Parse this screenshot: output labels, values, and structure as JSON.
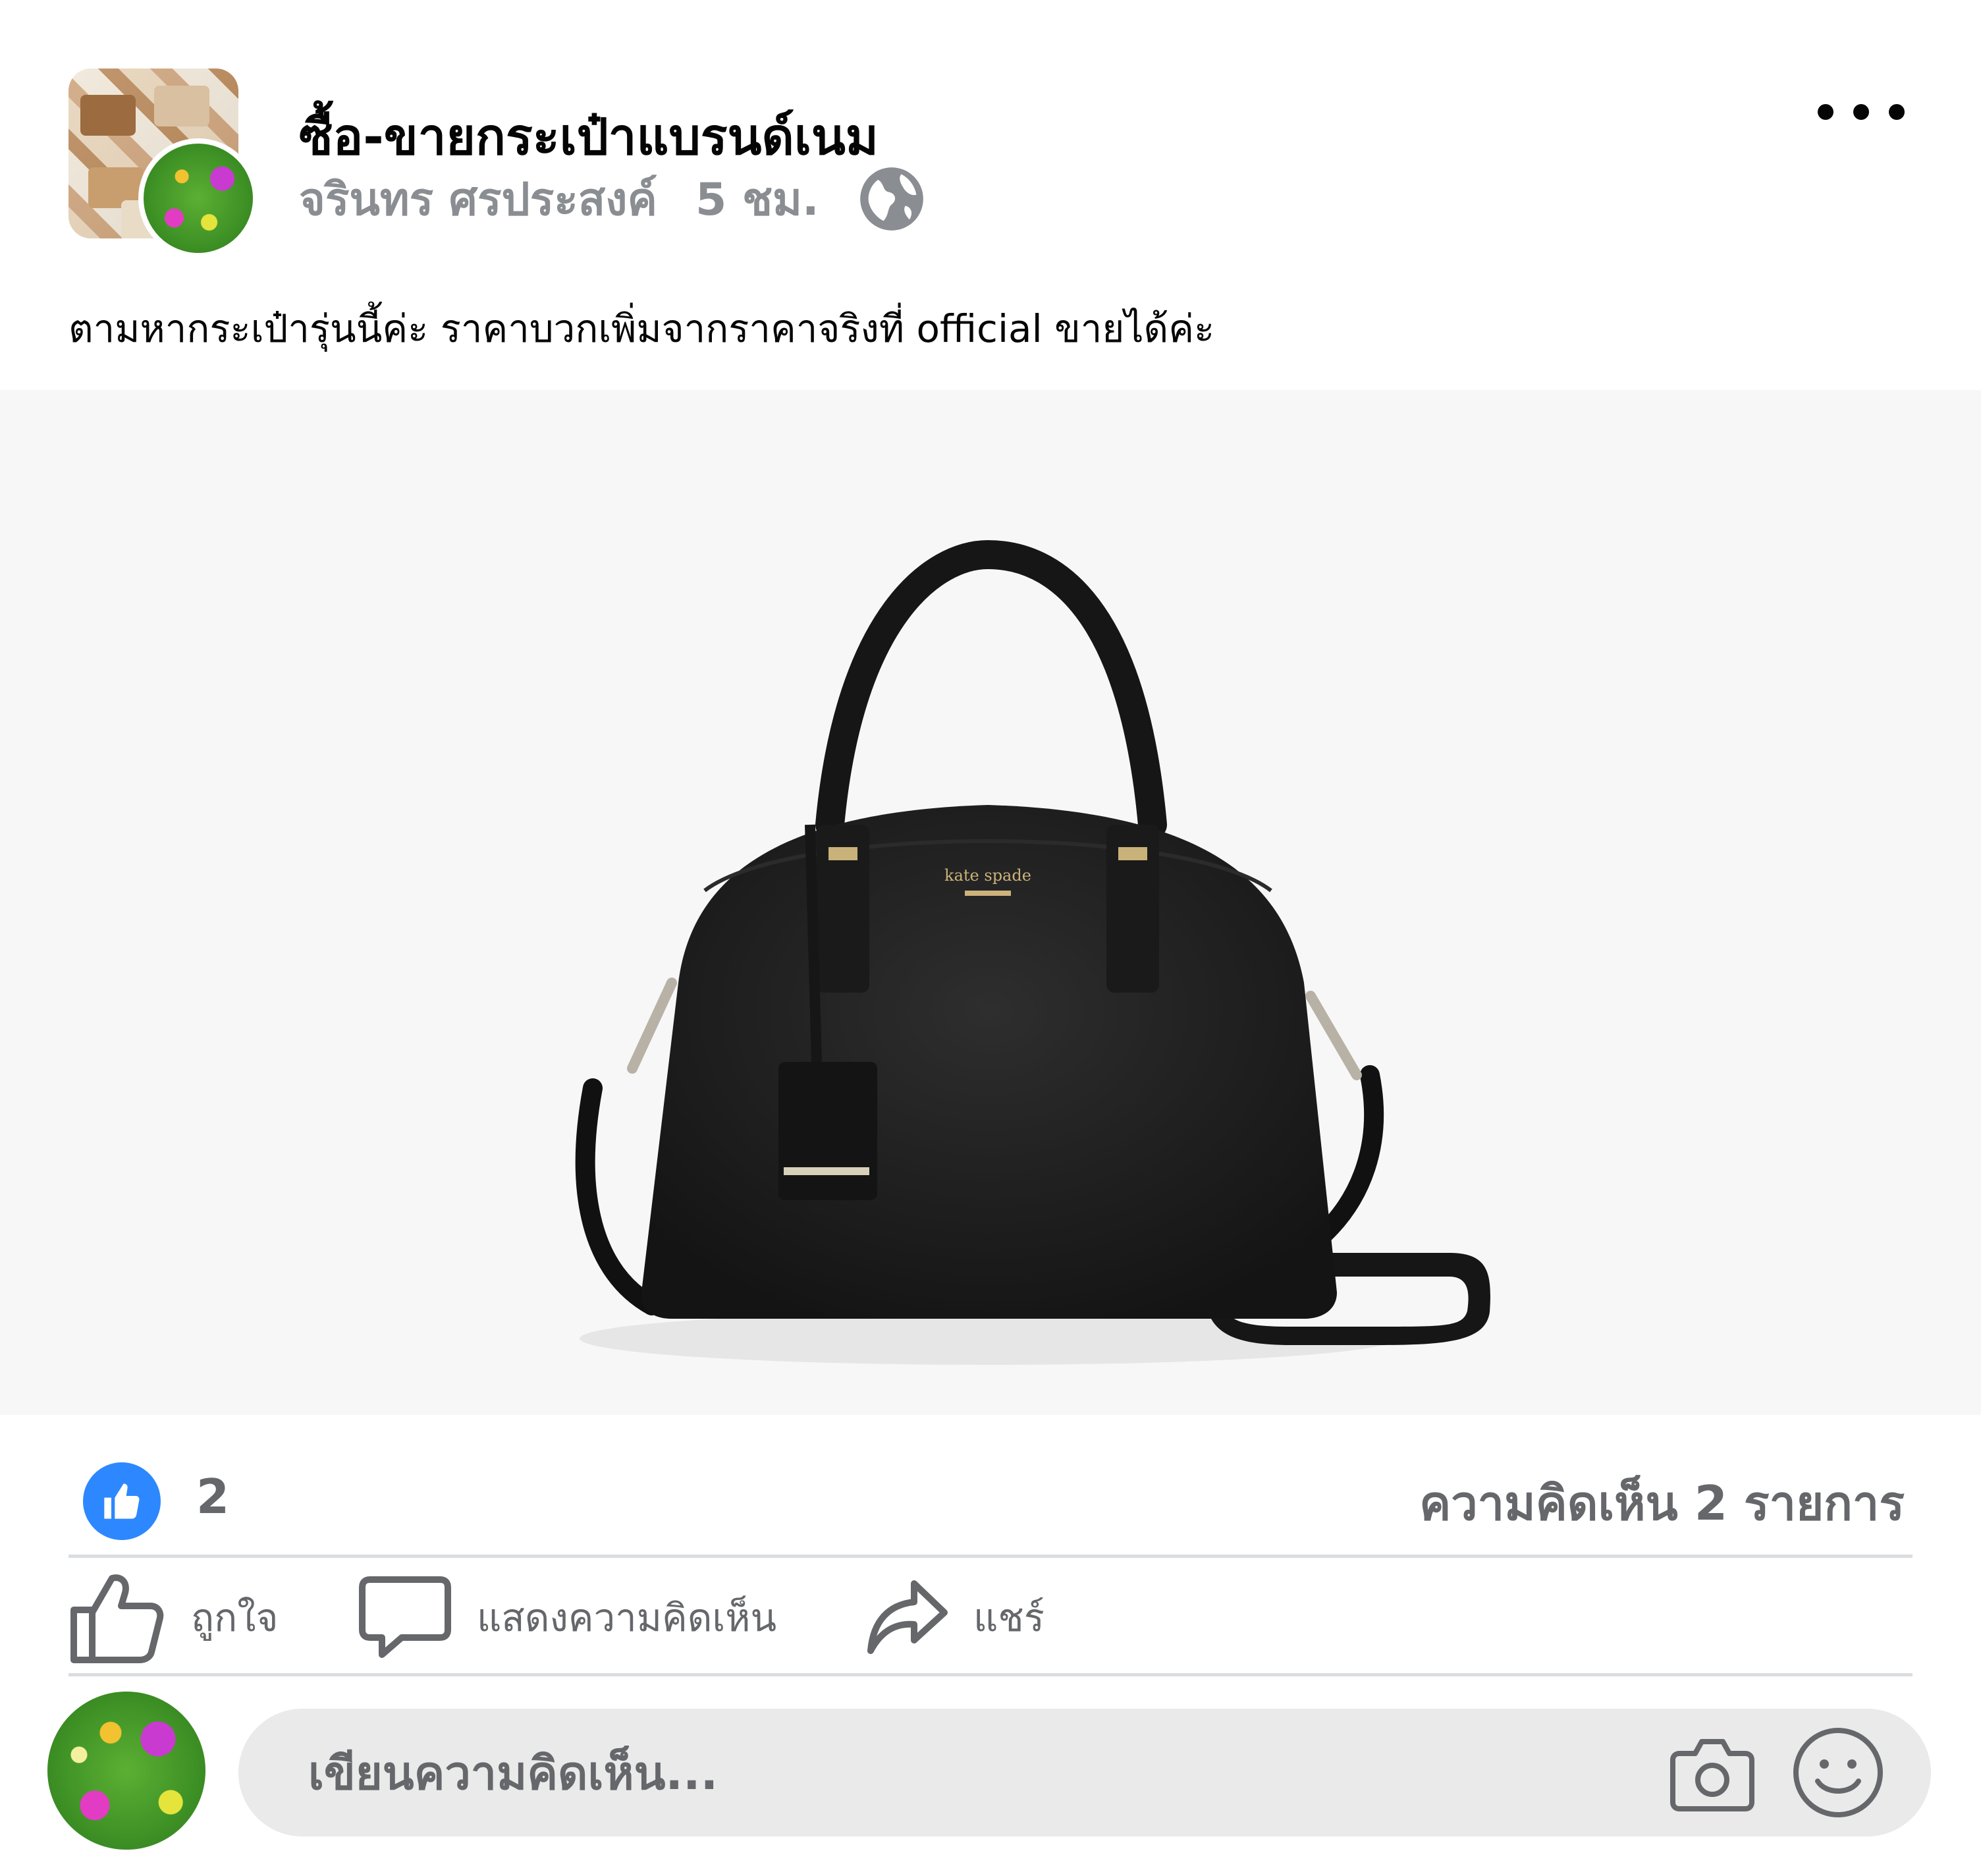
{
  "post": {
    "group_name": "ซื้อ-ขายกระเป๋าแบรนด์เนม",
    "author": "จรินทร ศรประสงค์",
    "time": "5 ชม.",
    "privacy_icon": "globe-icon",
    "more_icon": "more-options-icon",
    "text": "ตามหากระเป๋ารุ่นนี้ค่ะ ราคาบวกเพิ่มจากราคาจริงที่ official ขายได้ค่ะ",
    "image": {
      "brand_text": "kate spade",
      "icon": "handbag-photo"
    }
  },
  "stats": {
    "reaction_icon": "like-reaction-icon",
    "reaction_count": "2",
    "comments": "ความคิดเห็น 2 รายการ"
  },
  "actions": {
    "like": "ถูกใจ",
    "comment": "แสดงความคิดเห็น",
    "share": "แชร์"
  },
  "composer": {
    "placeholder": "เขียนความคิดเห็น...",
    "camera_icon": "camera-icon",
    "emoji_icon": "emoji-icon"
  },
  "colors": {
    "accent": "#2d88ff",
    "muted_text": "#65676b",
    "secondary_text": "#8a8d91",
    "composer_bg": "#eaeaea",
    "divider": "#dadde1"
  }
}
